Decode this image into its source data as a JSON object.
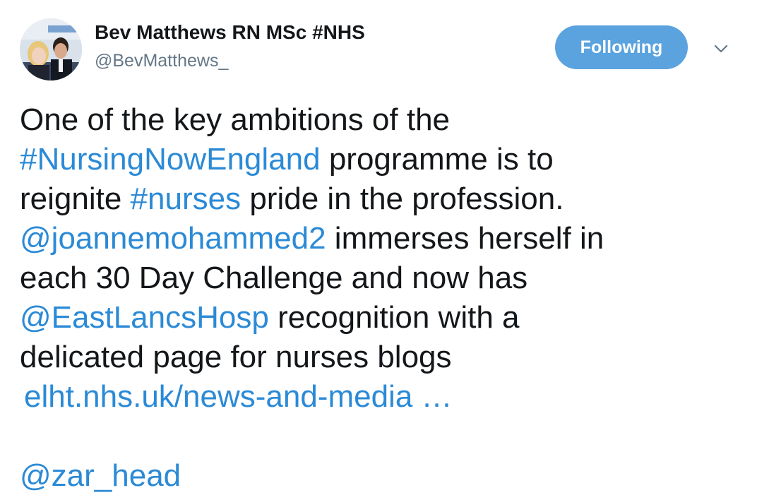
{
  "user": {
    "name": "Bev Matthews RN MSc #NHS",
    "handle": "@BevMatthews_"
  },
  "follow_button": {
    "label": "Following"
  },
  "tweet": {
    "line1": "One of the key ambitions of the",
    "hashtag_nursingnow": "#NursingNowEngland",
    "line2_rest": " programme is to",
    "line3_start": "reignite ",
    "hashtag_nurses": "#nurses",
    "line3_rest": " pride in the profession.",
    "mention_joanne": "@joannemohammed2",
    "line4_rest": " immerses herself in",
    "line5": "each 30 Day Challenge and now has",
    "mention_eastlancs": "@EastLancsHosp",
    "line6_rest": " recognition with a",
    "line7": "delicated page for nurses blogs",
    "url": "elht.nhs.uk/news-and-media …",
    "mention_zar": "@zar_head"
  },
  "colors": {
    "link": "#2b8ad6",
    "button": "#5ba3de",
    "text": "#14171a",
    "secondary": "#657786"
  },
  "icons": {
    "caret": "chevron-down-icon",
    "avatar": "profile-photo"
  }
}
